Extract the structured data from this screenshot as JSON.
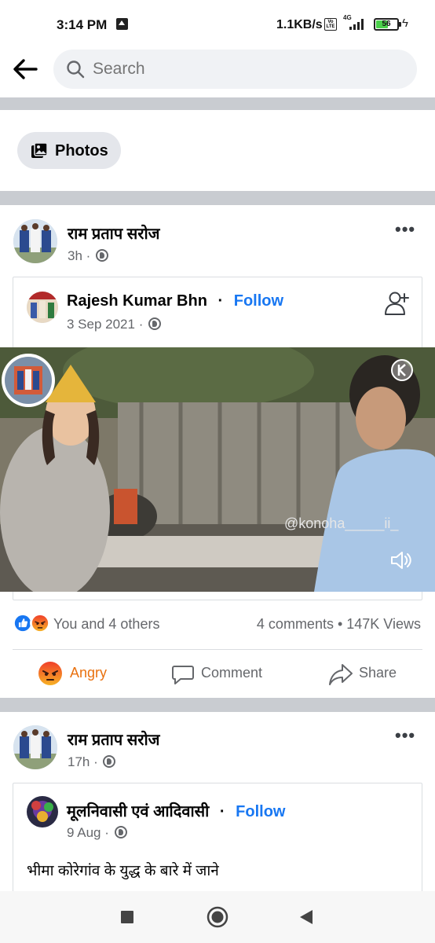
{
  "status_bar": {
    "time": "3:14 PM",
    "speed": "1.1KB/s",
    "volte": "Vo LTE",
    "network": "4G",
    "battery": "56",
    "battery_level": 0.56
  },
  "header": {
    "back_icon": "arrow-left-icon",
    "search_placeholder": "Search"
  },
  "filter": {
    "photos_label": "Photos",
    "photos_icon": "photos-icon"
  },
  "posts": [
    {
      "author": "राम प्रताप सरोज",
      "time": "3h ·",
      "privacy_icon": "globe-icon",
      "shared": {
        "author": "Rajesh Kumar Bhn",
        "follow_dot": "·",
        "follow": "Follow",
        "date": "3 Sep 2021 ·",
        "video_watermark": "@konoha_____ii_"
      },
      "reactions_text": "You and 4 others",
      "stats": "4 comments • 147K Views",
      "actions": {
        "react": "Angry",
        "comment": "Comment",
        "share": "Share"
      }
    },
    {
      "author": "राम प्रताप सरोज",
      "time": "17h ·",
      "privacy_icon": "globe-icon",
      "shared": {
        "author": "मूलनिवासी एवं आदिवासी",
        "follow_dot": "·",
        "follow": "Follow",
        "date": "9 Aug ·",
        "text": "भीमा कोरेगांव के युद्ध के बारे में जाने"
      }
    }
  ],
  "colors": {
    "accent": "#1877f2",
    "secondary_text": "#65676b",
    "angry": "#e9710f",
    "divider": "#c9ccd1"
  }
}
